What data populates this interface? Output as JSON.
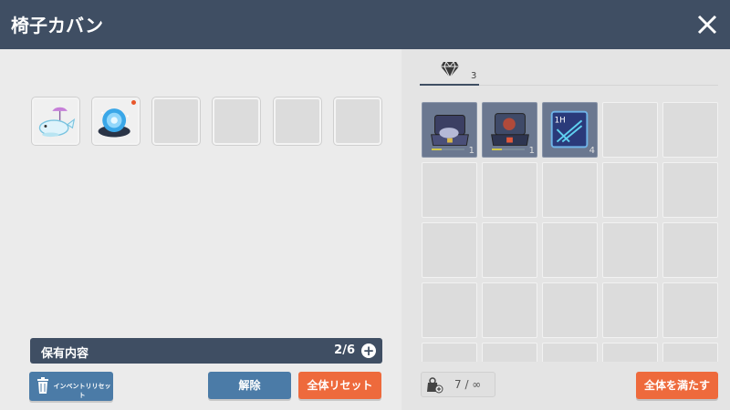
{
  "header": {
    "title": "椅子カバン"
  },
  "equip_slots": [
    {
      "icon": "whale-chair-icon",
      "new": false
    },
    {
      "icon": "blue-orb-chair-icon",
      "new": true
    },
    {
      "icon": ""
    },
    {
      "icon": ""
    },
    {
      "icon": ""
    },
    {
      "icon": ""
    }
  ],
  "summary": {
    "label": "保有内容",
    "count": "2/6"
  },
  "buttons": {
    "inventory_reset": "インベントリリセット",
    "release": "解除",
    "reset_all": "全体リセット",
    "fill_all": "全体を満たす"
  },
  "tab": {
    "icon": "diamond-icon",
    "count": "3"
  },
  "inventory_items": [
    {
      "icon": "chest-chair-icon",
      "qty": "1"
    },
    {
      "icon": "chest-chair-red-icon",
      "qty": "1"
    },
    {
      "icon": "1h-ticket-icon",
      "qty": "4"
    }
  ],
  "capacity": {
    "text": "7 / ∞"
  },
  "colors": {
    "header": "#3f4e63",
    "accent_orange": "#ee6a3c",
    "accent_blue": "#4b7ba7"
  }
}
